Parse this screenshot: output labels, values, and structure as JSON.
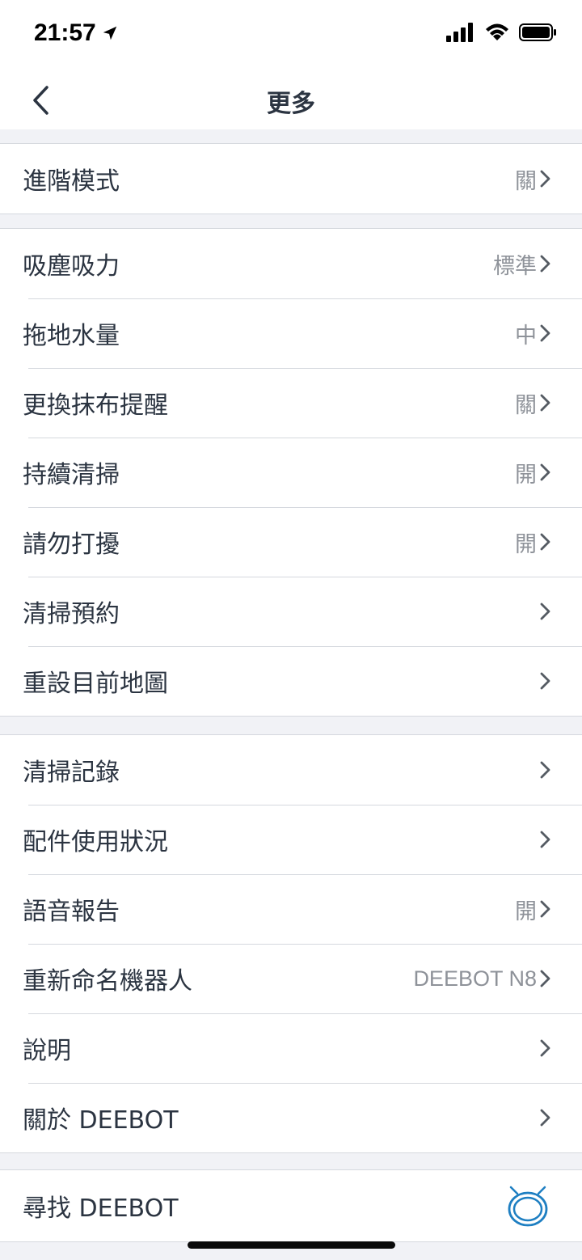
{
  "status_bar": {
    "time": "21:57",
    "icons": [
      "location-arrow-icon",
      "cellular-signal-icon",
      "wifi-icon",
      "battery-icon"
    ]
  },
  "nav": {
    "title": "更多",
    "back_icon": "chevron-left-icon"
  },
  "sections": [
    {
      "items": [
        {
          "label": "進階模式",
          "value": "關"
        }
      ]
    },
    {
      "items": [
        {
          "label": "吸塵吸力",
          "value": "標準"
        },
        {
          "label": "拖地水量",
          "value": "中"
        },
        {
          "label": "更換抹布提醒",
          "value": "關"
        },
        {
          "label": "持續清掃",
          "value": "開"
        },
        {
          "label": "請勿打擾",
          "value": "開"
        },
        {
          "label": "清掃預約",
          "value": ""
        },
        {
          "label": "重設目前地圖",
          "value": ""
        }
      ]
    },
    {
      "items": [
        {
          "label": "清掃記錄",
          "value": ""
        },
        {
          "label": "配件使用狀況",
          "value": ""
        },
        {
          "label": "語音報告",
          "value": "開"
        },
        {
          "label": "重新命名機器人",
          "value": "DEEBOT N8"
        },
        {
          "label": "說明",
          "value": ""
        },
        {
          "label": "關於 DEEBOT",
          "value": ""
        }
      ]
    },
    {
      "items": [
        {
          "label": "尋找 DEEBOT",
          "value": "",
          "icon": "robot-icon"
        }
      ]
    }
  ],
  "colors": {
    "accent": "#1e7fc2",
    "text": "#2b3441",
    "secondary_text": "#8e9299",
    "background": "#f1f2f6"
  }
}
